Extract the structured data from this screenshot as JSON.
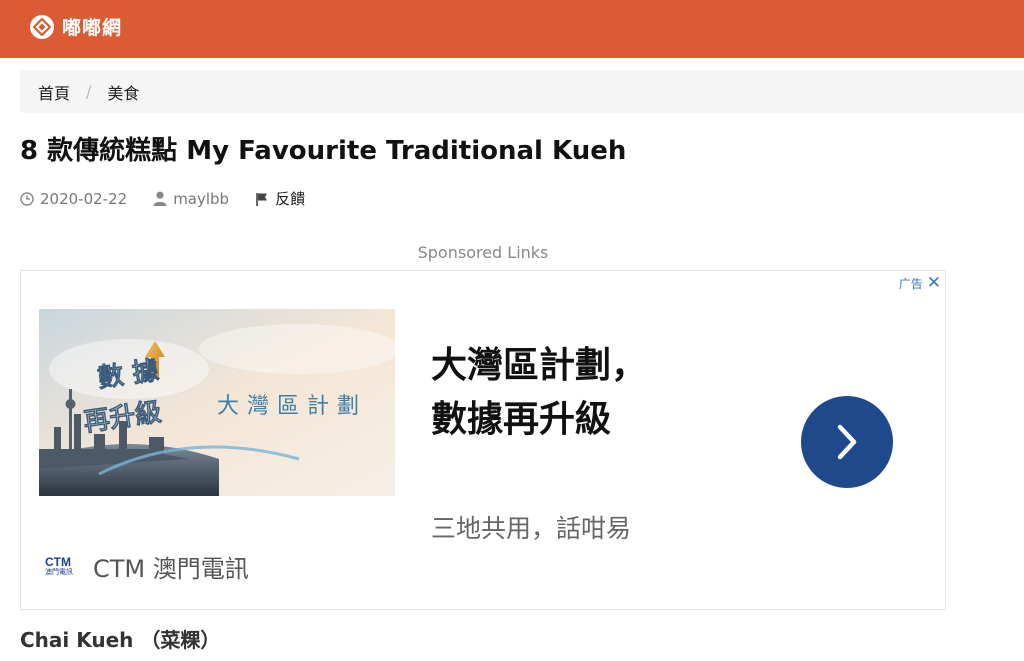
{
  "site": {
    "logo_text": "嘟嘟網",
    "logo_icon": "diamond-logo-icon",
    "brand_color": "#db5c32"
  },
  "breadcrumb": {
    "home": "首頁",
    "separator": "/",
    "category": "美食"
  },
  "article": {
    "title": "8 款傳統糕點 My Favourite Traditional Kueh",
    "date": "2020-02-22",
    "author": "maylbb",
    "feedback": "反饋",
    "section_heading": "Chai Kueh （菜粿）"
  },
  "ad": {
    "sponsored_label": "Sponsored Links",
    "adchoice_label": "广告",
    "image_text_left": "數據再升級",
    "image_text_right": "大灣區計劃",
    "headline_line1": "大灣區計劃，",
    "headline_line2": "數據再升級",
    "subtext": "三地共用，話咁易",
    "brand_logo": "CTM",
    "brand_logo_sub": "澳門電訊",
    "brand_name": "CTM 澳門電訊",
    "cta_color": "#1e4a8c"
  }
}
